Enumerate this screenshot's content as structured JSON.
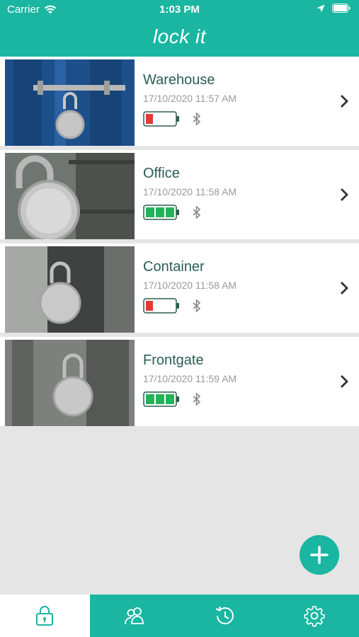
{
  "status_bar": {
    "carrier": "Carrier",
    "time": "1:03 PM"
  },
  "header": {
    "title": "lock it"
  },
  "locks": [
    {
      "name": "Warehouse",
      "date": "17/10/2020 11:57 AM",
      "battery": "low",
      "battery_color": "#e53935"
    },
    {
      "name": "Office",
      "date": "17/10/2020 11:58 AM",
      "battery": "full",
      "battery_color": "#22b35a"
    },
    {
      "name": "Container",
      "date": "17/10/2020 11:58 AM",
      "battery": "low",
      "battery_color": "#e53935"
    },
    {
      "name": "Frontgate",
      "date": "17/10/2020 11:59 AM",
      "battery": "full",
      "battery_color": "#22b35a"
    }
  ],
  "colors": {
    "accent": "#1ab6a1",
    "name_text": "#2b5d52",
    "date_text": "#9a9a9a"
  },
  "tabs": [
    {
      "icon": "lock-icon",
      "active": true
    },
    {
      "icon": "users-icon",
      "active": false
    },
    {
      "icon": "history-icon",
      "active": false
    },
    {
      "icon": "gear-icon",
      "active": false
    }
  ]
}
